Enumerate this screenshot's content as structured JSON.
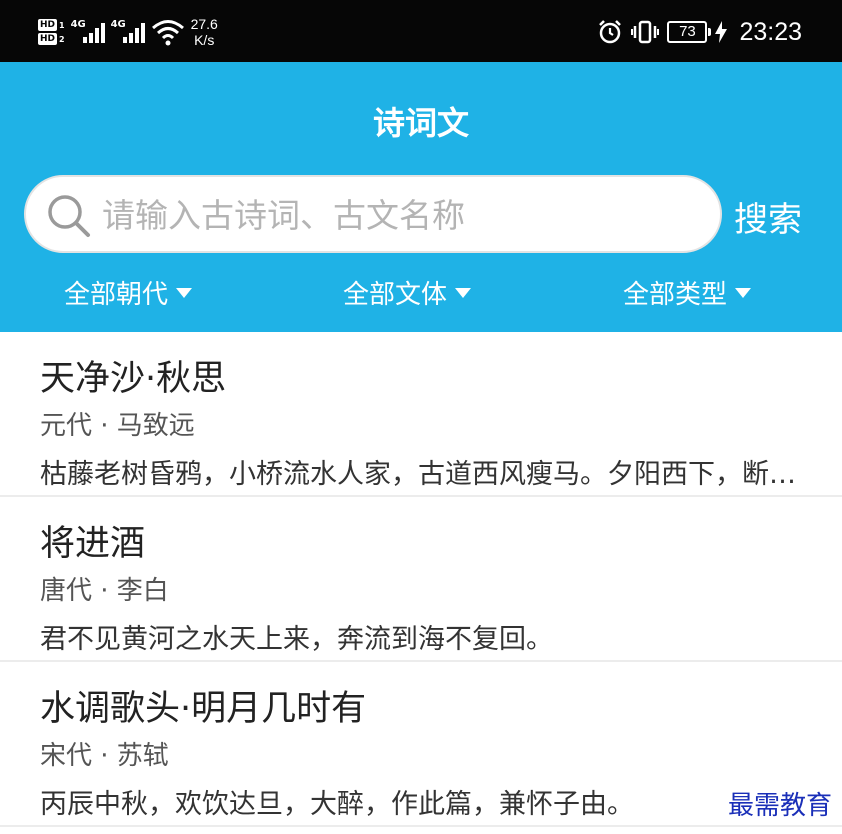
{
  "status_bar": {
    "sim1_label": "HD",
    "sim1_num": "1",
    "sim2_label": "HD",
    "sim2_num": "2",
    "net1": "4G",
    "net2": "4G",
    "speed_value": "27.6",
    "speed_unit": "K/s",
    "battery": "73",
    "time": "23:23",
    "icons": [
      "alarm-icon",
      "vibrate-icon",
      "battery-icon",
      "charging-icon",
      "wifi-icon",
      "signal-icon"
    ]
  },
  "header": {
    "title": "诗词文",
    "background_color": "#1fb2e6"
  },
  "search": {
    "placeholder": "请输入古诗词、古文名称",
    "value": "",
    "button_label": "搜索"
  },
  "filters": [
    {
      "label": "全部朝代"
    },
    {
      "label": "全部文体"
    },
    {
      "label": "全部类型"
    }
  ],
  "poems": [
    {
      "title": "天净沙·秋思",
      "author": "元代 · 马致远",
      "excerpt": "枯藤老树昏鸦，小桥流水人家，古道西风瘦马。夕阳西下，断肠人在天涯。"
    },
    {
      "title": "将进酒",
      "author": "唐代 · 李白",
      "excerpt": "君不见黄河之水天上来，奔流到海不复回。"
    },
    {
      "title": "水调歌头·明月几时有",
      "author": "宋代 · 苏轼",
      "excerpt": "丙辰中秋，欢饮达旦，大醉，作此篇，兼怀子由。"
    }
  ],
  "watermark": "最需教育"
}
